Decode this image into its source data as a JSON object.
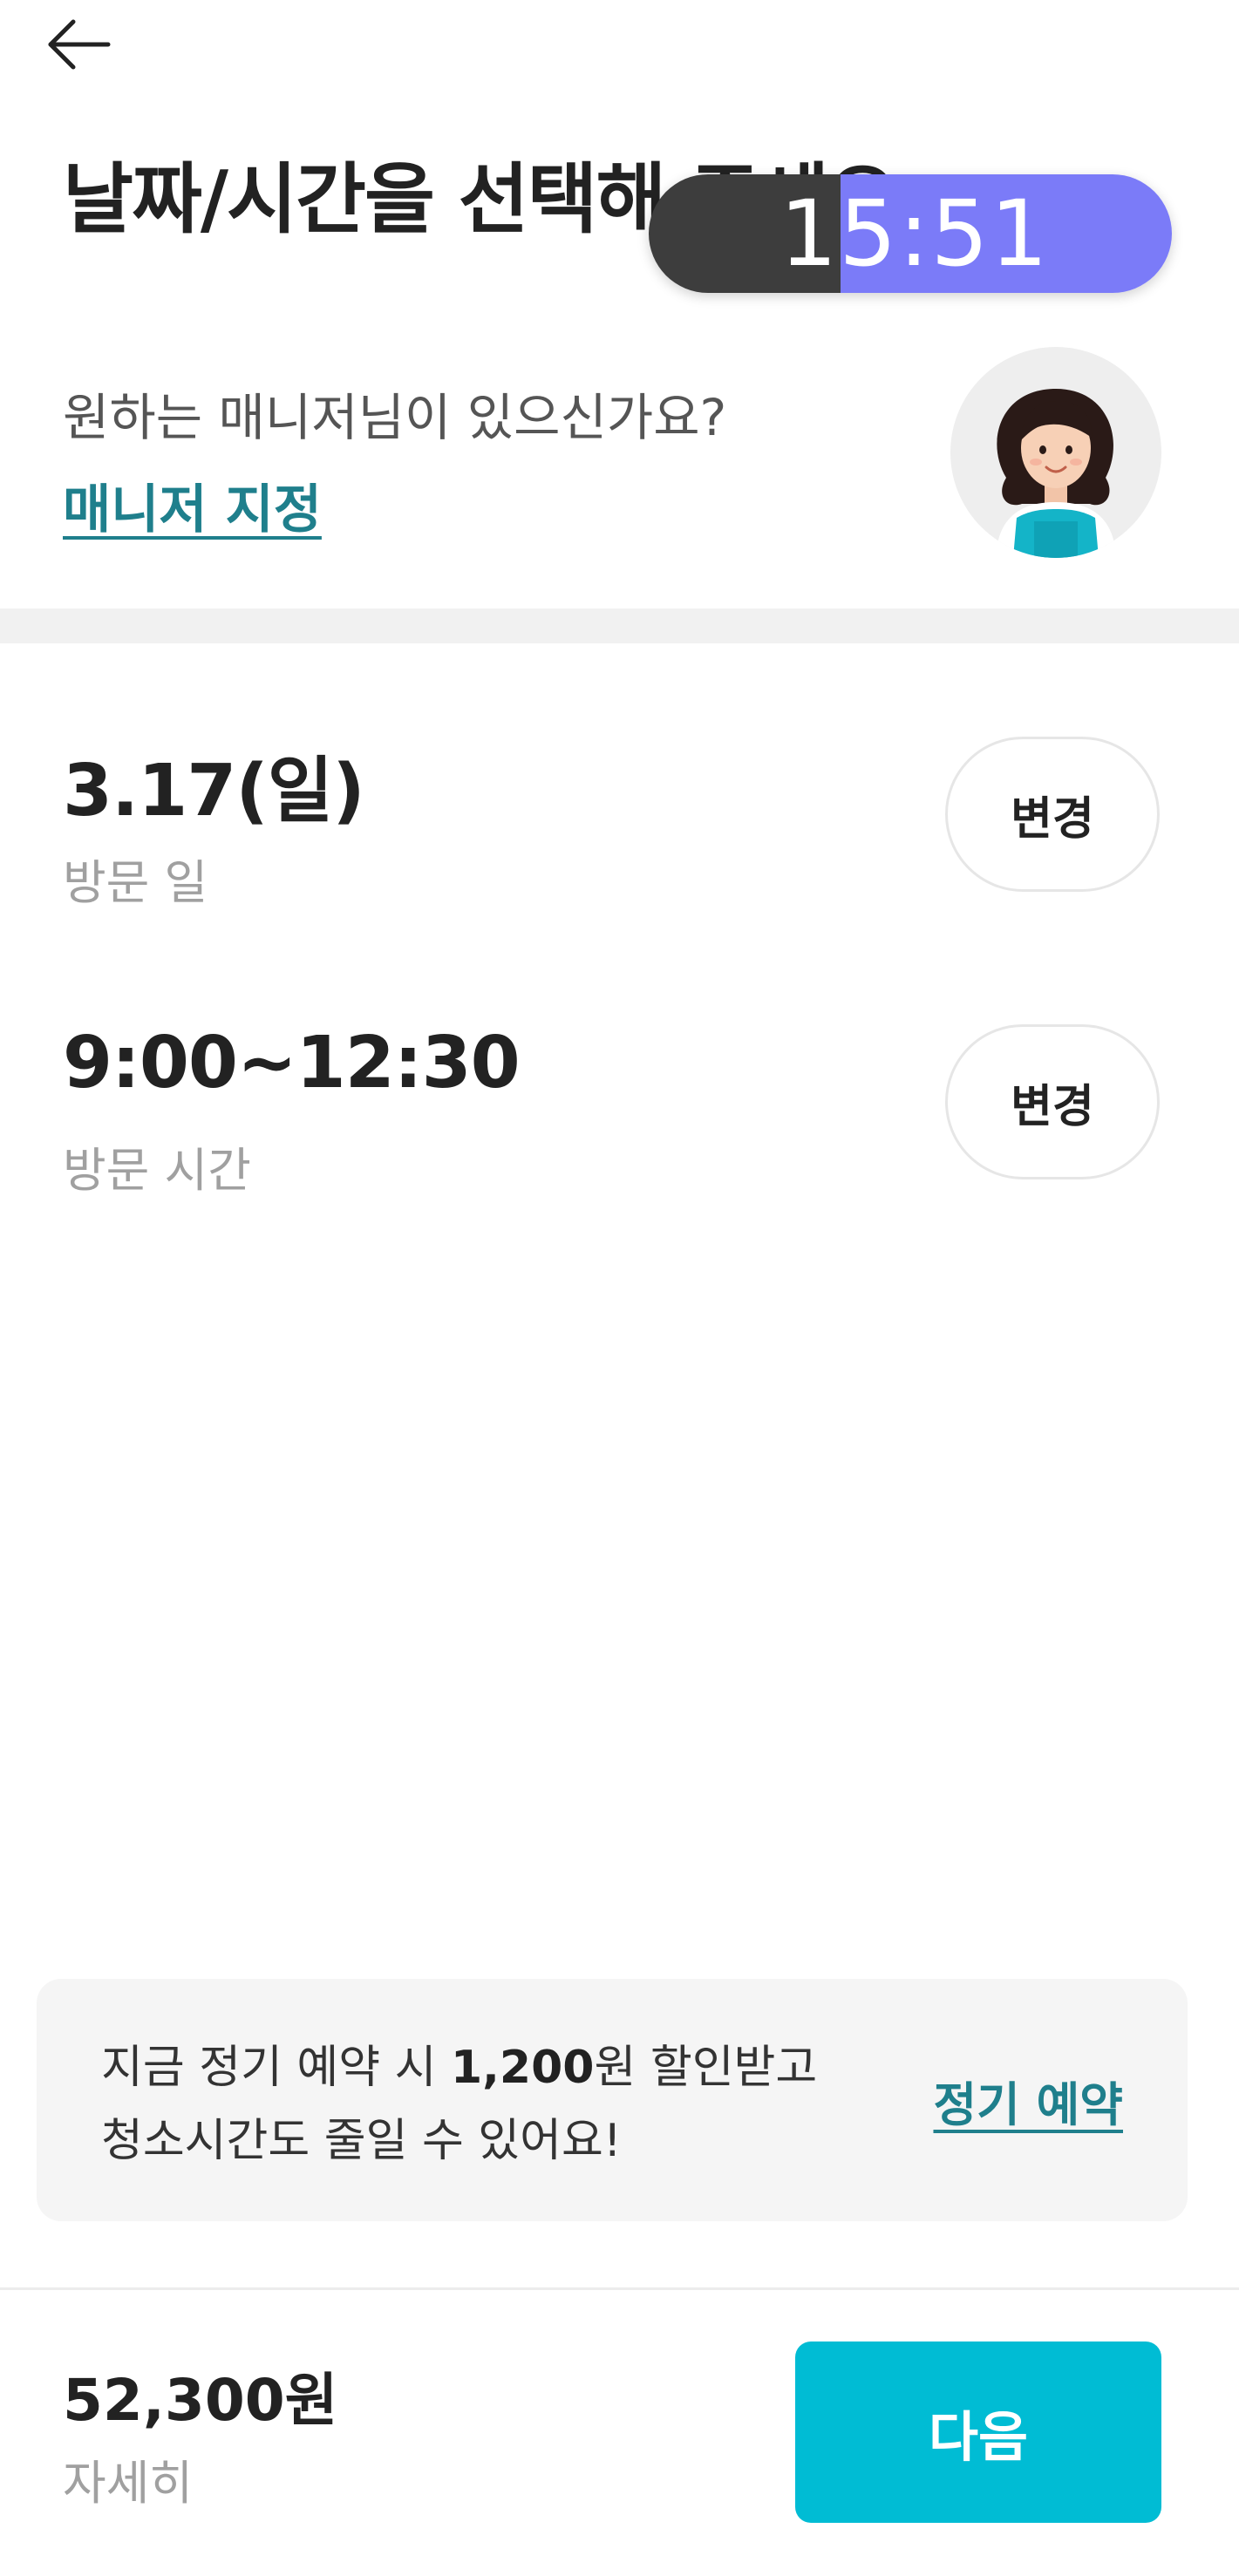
{
  "header": {
    "title": "날짜/시간을 선택해 주세요",
    "back_icon": "arrow-left-icon"
  },
  "timer": {
    "text": "15:51",
    "left_color": "#3d3d3d",
    "right_color": "#7b7bf8"
  },
  "manager": {
    "question": "원하는 매니저님이 있으신가요?",
    "link_label": "매니저 지정",
    "avatar_icon": "manager-avatar-icon"
  },
  "visit_date": {
    "value": "3.17(일)",
    "label": "방문 일",
    "change_label": "변경"
  },
  "visit_time": {
    "value": "9:00~12:30",
    "label": "방문 시간",
    "change_label": "변경"
  },
  "promo": {
    "line1_prefix": "지금 정기 예약 시 ",
    "line1_amount": "1,200",
    "line1_suffix": "원 할인받고",
    "line2": "청소시간도 줄일 수 있어요!",
    "link_label": "정기 예약"
  },
  "footer": {
    "price": "52,300원",
    "details_label": "자세히",
    "next_label": "다음"
  },
  "colors": {
    "accent": "#00bcd4",
    "link": "#1f7f8c",
    "muted_text": "#a0a0a0"
  }
}
